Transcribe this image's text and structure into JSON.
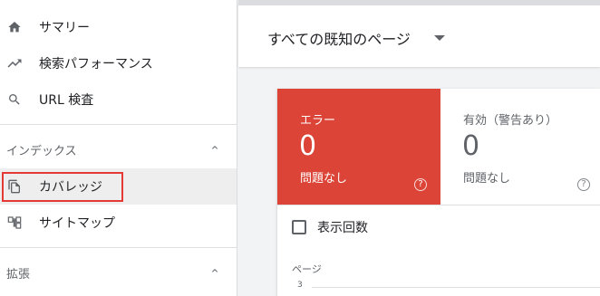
{
  "sidebar": {
    "items": [
      {
        "label": "サマリー",
        "icon": "home-icon"
      },
      {
        "label": "検索パフォーマンス",
        "icon": "trending-up-icon"
      },
      {
        "label": "URL 検査",
        "icon": "search-icon"
      }
    ],
    "sections": [
      {
        "title": "インデックス",
        "items": [
          {
            "label": "カバレッジ",
            "icon": "coverage-icon",
            "active": true
          },
          {
            "label": "サイトマップ",
            "icon": "sitemap-icon"
          }
        ]
      },
      {
        "title": "拡張",
        "items": []
      }
    ]
  },
  "header": {
    "selector_label": "すべての既知のページ"
  },
  "summary": {
    "error": {
      "label": "エラー",
      "value": "0",
      "sub": "問題なし"
    },
    "valid_warning": {
      "label": "有効（警告あり）",
      "value": "0",
      "sub": "問題なし"
    },
    "help_symbol": "?"
  },
  "chart": {
    "toggle_label": "表示回数",
    "y_title": "ページ",
    "y_tick": "3"
  },
  "colors": {
    "error_tile": "#db4437",
    "highlight": "#e53935"
  }
}
